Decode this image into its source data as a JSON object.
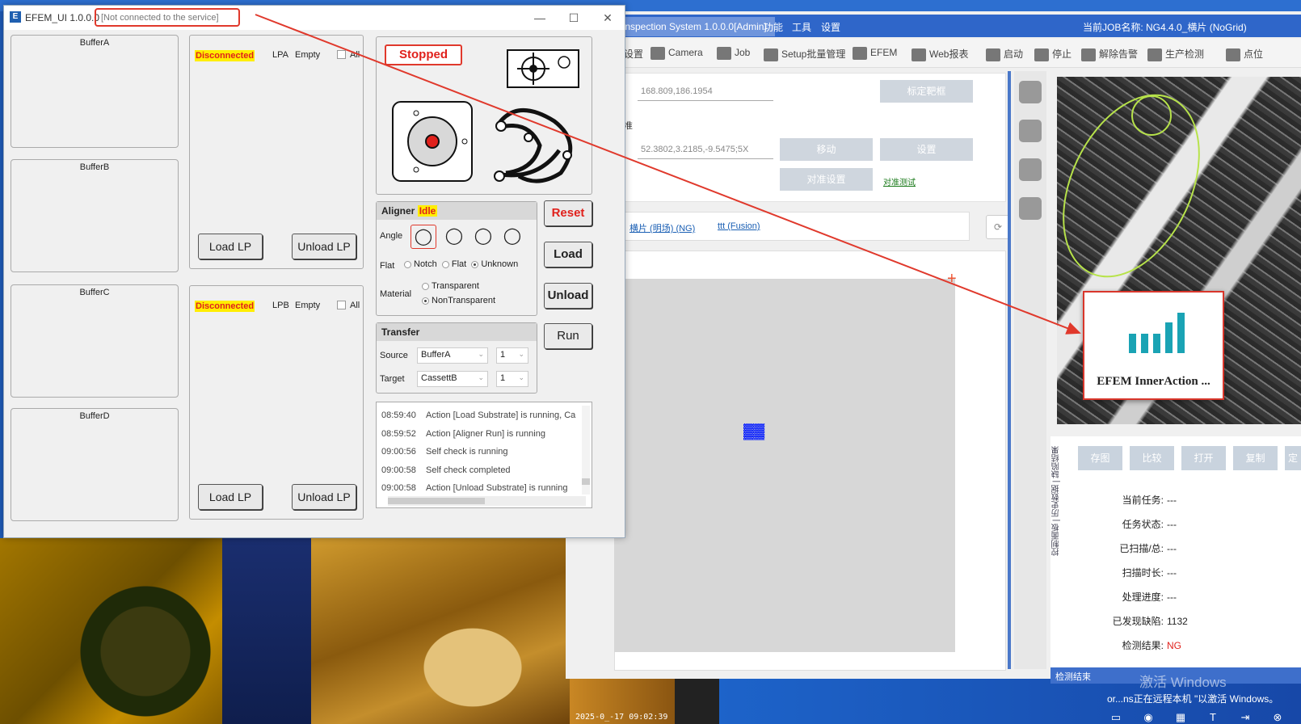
{
  "efem": {
    "window_title": "EFEM_UI 1.0.0.0",
    "connection_status": "[Not connected to the service]",
    "buffers": [
      "BufferA",
      "BufferB",
      "BufferC",
      "BufferD"
    ],
    "load_ports": [
      {
        "status": "Disconnected",
        "name": "LPA",
        "state": "Empty",
        "all_label": "All",
        "load": "Load LP",
        "unload": "Unload LP"
      },
      {
        "status": "Disconnected",
        "name": "LPB",
        "state": "Empty",
        "all_label": "All",
        "load": "Load LP",
        "unload": "Unload LP"
      }
    ],
    "robot_status": "Stopped",
    "aligner": {
      "title": "Aligner",
      "status": "Idle",
      "angle_label": "Angle",
      "flat_label": "Flat",
      "flat_options": [
        "Notch",
        "Flat",
        "Unknown"
      ],
      "flat_selected": "Unknown",
      "material_label": "Material",
      "material_options": [
        "Transparent",
        "NonTransparent"
      ],
      "material_selected": "NonTransparent"
    },
    "transfer": {
      "title": "Transfer",
      "source_label": "Source",
      "source_value": "BufferA",
      "source_slot": "1",
      "target_label": "Target",
      "target_value": "CassettB",
      "target_slot": "1"
    },
    "buttons": {
      "reset": "Reset",
      "load": "Load",
      "unload": "Unload",
      "run": "Run"
    },
    "log": [
      {
        "time": "08:59:40",
        "msg": "Action [Load Substrate] is running, Ca"
      },
      {
        "time": "08:59:52",
        "msg": "Action [Aligner Run] is running"
      },
      {
        "time": "09:00:56",
        "msg": "Self check is running"
      },
      {
        "time": "09:00:58",
        "msg": "Self check completed"
      },
      {
        "time": "09:00:58",
        "msg": "Action [Unload Substrate] is running"
      }
    ]
  },
  "inspection": {
    "title": "Inspection System 1.0.0.0[Admin]",
    "menu": [
      "功能",
      "工具",
      "设置"
    ],
    "job_name": "当前JOB名称: NG4.4.0_横片 (NoGrid)",
    "toolbar": [
      "块设置",
      "Camera",
      "Job",
      "Setup批量管理",
      "EFEM",
      "Web报表",
      "启动",
      "停止",
      "解除告警",
      "生产检测",
      "点位"
    ],
    "field1": "168.809,186.1954",
    "field2": "52.3802,3.2185,-9.5475;5X",
    "label_align": "对准",
    "btn_calib": "标定靶框",
    "btn_move": "移动",
    "btn_set": "设置",
    "btn_align_set": "对准设置",
    "link_align_test": "对准测试",
    "tabs": [
      "横片 (明场) (NG)",
      "ttt (Fusion)"
    ],
    "popup_label": "EFEM InnerAction ...",
    "result_side_tabs": "控制面板 | 历史数据 | 缺陷结果",
    "result_buttons": [
      "存图",
      "比较",
      "打开",
      "复制",
      "定"
    ],
    "results": [
      {
        "k": "当前任务:",
        "v": "---"
      },
      {
        "k": "任务状态:",
        "v": "---"
      },
      {
        "k": "已扫描/总:",
        "v": "---"
      },
      {
        "k": "扫描时长:",
        "v": "---"
      },
      {
        "k": "处理进度:",
        "v": "---"
      },
      {
        "k": "已发现缺陷:",
        "v": "1132"
      },
      {
        "k": "检测结果:",
        "v": "NG"
      }
    ],
    "status_bar": "检测结束"
  },
  "desktop": {
    "activate_watermark": "激活 Windows",
    "remote_note": "or...ns正在远程本机 \"以激活 Windows。",
    "camera_timestamp": "2025-0_-17 09:02:39"
  },
  "colors": {
    "accent_red": "#e0392c",
    "warn_yellow": "#ffee00",
    "title_blue": "#2f66c9"
  }
}
